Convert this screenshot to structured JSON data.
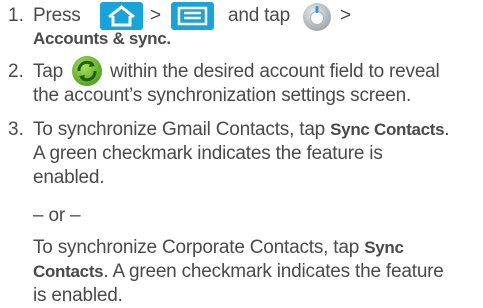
{
  "steps": [
    {
      "number": "1.",
      "lines": {
        "press": "Press",
        "gt1": ">",
        "and_tap": "and tap",
        "gt2": ">",
        "target": "Accounts & sync."
      },
      "icons": [
        "home-key-icon",
        "menu-key-icon",
        "settings-icon"
      ]
    },
    {
      "number": "2.",
      "lines": {
        "tap": "Tap",
        "rest": "within the desired account field to reveal",
        "line2": "the account’s synchronization settings screen."
      },
      "icons": [
        "sync-icon"
      ]
    },
    {
      "number": "3.",
      "lines": {
        "line1_pre": "To synchronize Gmail Contacts, tap ",
        "line1_bold": "Sync Contacts",
        "line1_post": ".",
        "line2": "A green checkmark indicates the feature is",
        "line3": "enabled.",
        "or": "– or –",
        "line4_pre": "To synchronize Corporate Contacts, tap ",
        "line4_bold": "Sync",
        "line5_bold": "Contacts",
        "line5_post": ". A green checkmark indicates the feature",
        "line6": "is enabled."
      }
    }
  ],
  "colors": {
    "text": "#4a4a4a",
    "key_blue": "#1aa3d8",
    "sync_green": "#6cbf2a",
    "settings_gray": "#9ca3a8"
  }
}
